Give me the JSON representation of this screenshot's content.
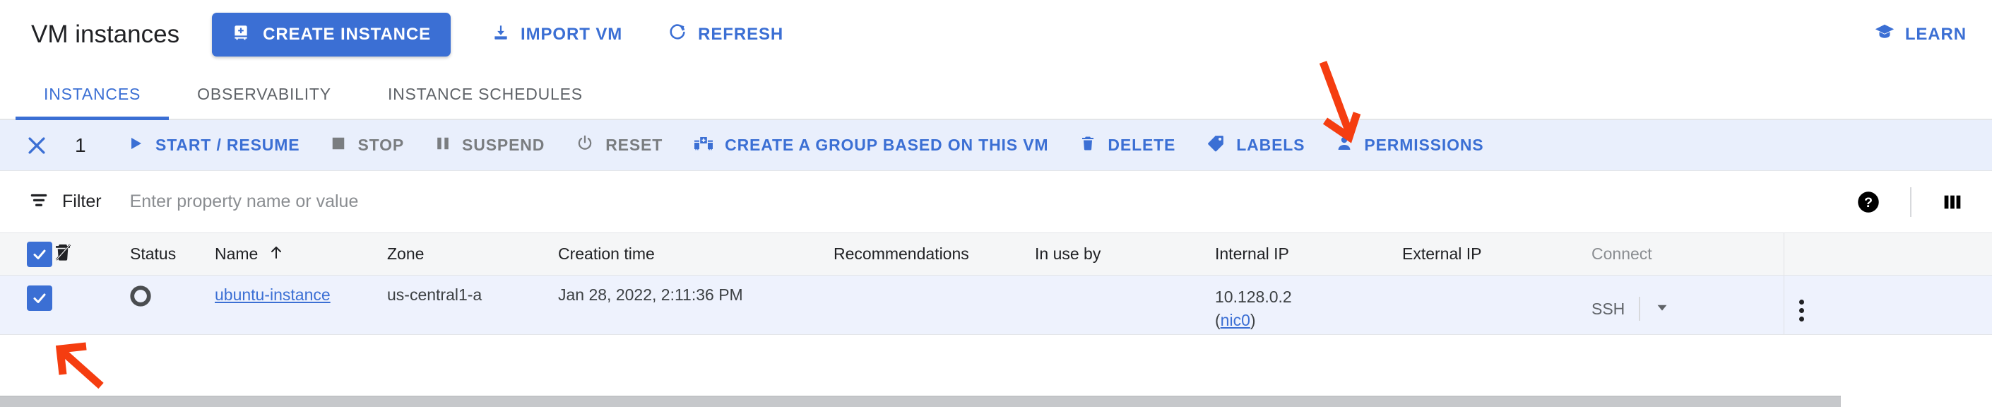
{
  "header": {
    "title": "VM instances",
    "create_button": {
      "label": "CREATE INSTANCE",
      "icon": "create-instance-icon"
    },
    "import_button": {
      "label": "IMPORT VM",
      "icon": "download-icon"
    },
    "refresh_button": {
      "label": "REFRESH",
      "icon": "refresh-icon"
    },
    "learn_button": {
      "label": "LEARN",
      "icon": "graduation-cap-icon"
    },
    "accent_color": "#3b6fd4"
  },
  "tabs": [
    {
      "label": "INSTANCES",
      "active": true
    },
    {
      "label": "OBSERVABILITY",
      "active": false
    },
    {
      "label": "INSTANCE SCHEDULES",
      "active": false
    }
  ],
  "action_bar": {
    "background_color": "#e9effc",
    "close_icon": "close-icon",
    "selected_count": "1",
    "actions": [
      {
        "label": "START / RESUME",
        "icon": "play-icon",
        "enabled": true
      },
      {
        "label": "STOP",
        "icon": "stop-square-icon",
        "enabled": false
      },
      {
        "label": "SUSPEND",
        "icon": "pause-icon",
        "enabled": false
      },
      {
        "label": "RESET",
        "icon": "power-reset-icon",
        "enabled": false
      },
      {
        "label": "CREATE A GROUP BASED ON THIS VM",
        "icon": "create-group-icon",
        "enabled": true
      },
      {
        "label": "DELETE",
        "icon": "trash-icon",
        "enabled": true
      },
      {
        "label": "LABELS",
        "icon": "tag-icon",
        "enabled": true
      },
      {
        "label": "PERMISSIONS",
        "icon": "person-icon",
        "enabled": true
      }
    ]
  },
  "filter_bar": {
    "icon": "filter-icon",
    "label": "Filter",
    "placeholder": "Enter property name or value",
    "value": "",
    "help_icon": "help-circle-icon",
    "columns_icon": "column-display-icon"
  },
  "table": {
    "headers": {
      "select_all": "select-all-checkbox",
      "delete_protection_icon": "delete-protection-icon",
      "status": "Status",
      "name": "Name",
      "name_sort_icon": "sort-ascending-arrow-icon",
      "zone": "Zone",
      "creation_time": "Creation time",
      "recommendations": "Recommendations",
      "in_use_by": "In use by",
      "internal_ip": "Internal IP",
      "external_ip": "External IP",
      "connect": "Connect"
    },
    "rows": [
      {
        "selected": true,
        "status_icon": "stopped-circle-icon",
        "name": "ubuntu-instance",
        "zone": "us-central1-a",
        "creation_time": "Jan 28, 2022, 2:11:36 PM",
        "recommendations": "",
        "in_use_by": "",
        "internal_ip": "10.128.0.2",
        "internal_ip_nic_open": "(",
        "internal_ip_nic": "nic0",
        "internal_ip_nic_close": ")",
        "external_ip": "",
        "connect_label": "SSH",
        "connect_caret_icon": "chevron-down-icon",
        "row_menu_icon": "kebab-menu-icon"
      }
    ]
  },
  "annotations": {
    "color": "#f53d10",
    "arrows": [
      {
        "name": "arrow-pointing-to-delete",
        "target": "DELETE"
      },
      {
        "name": "arrow-pointing-to-row-checkbox",
        "target": "row checkbox"
      }
    ]
  },
  "scrollbar": {
    "name": "horizontal-scrollbar",
    "orientation": "horizontal"
  }
}
